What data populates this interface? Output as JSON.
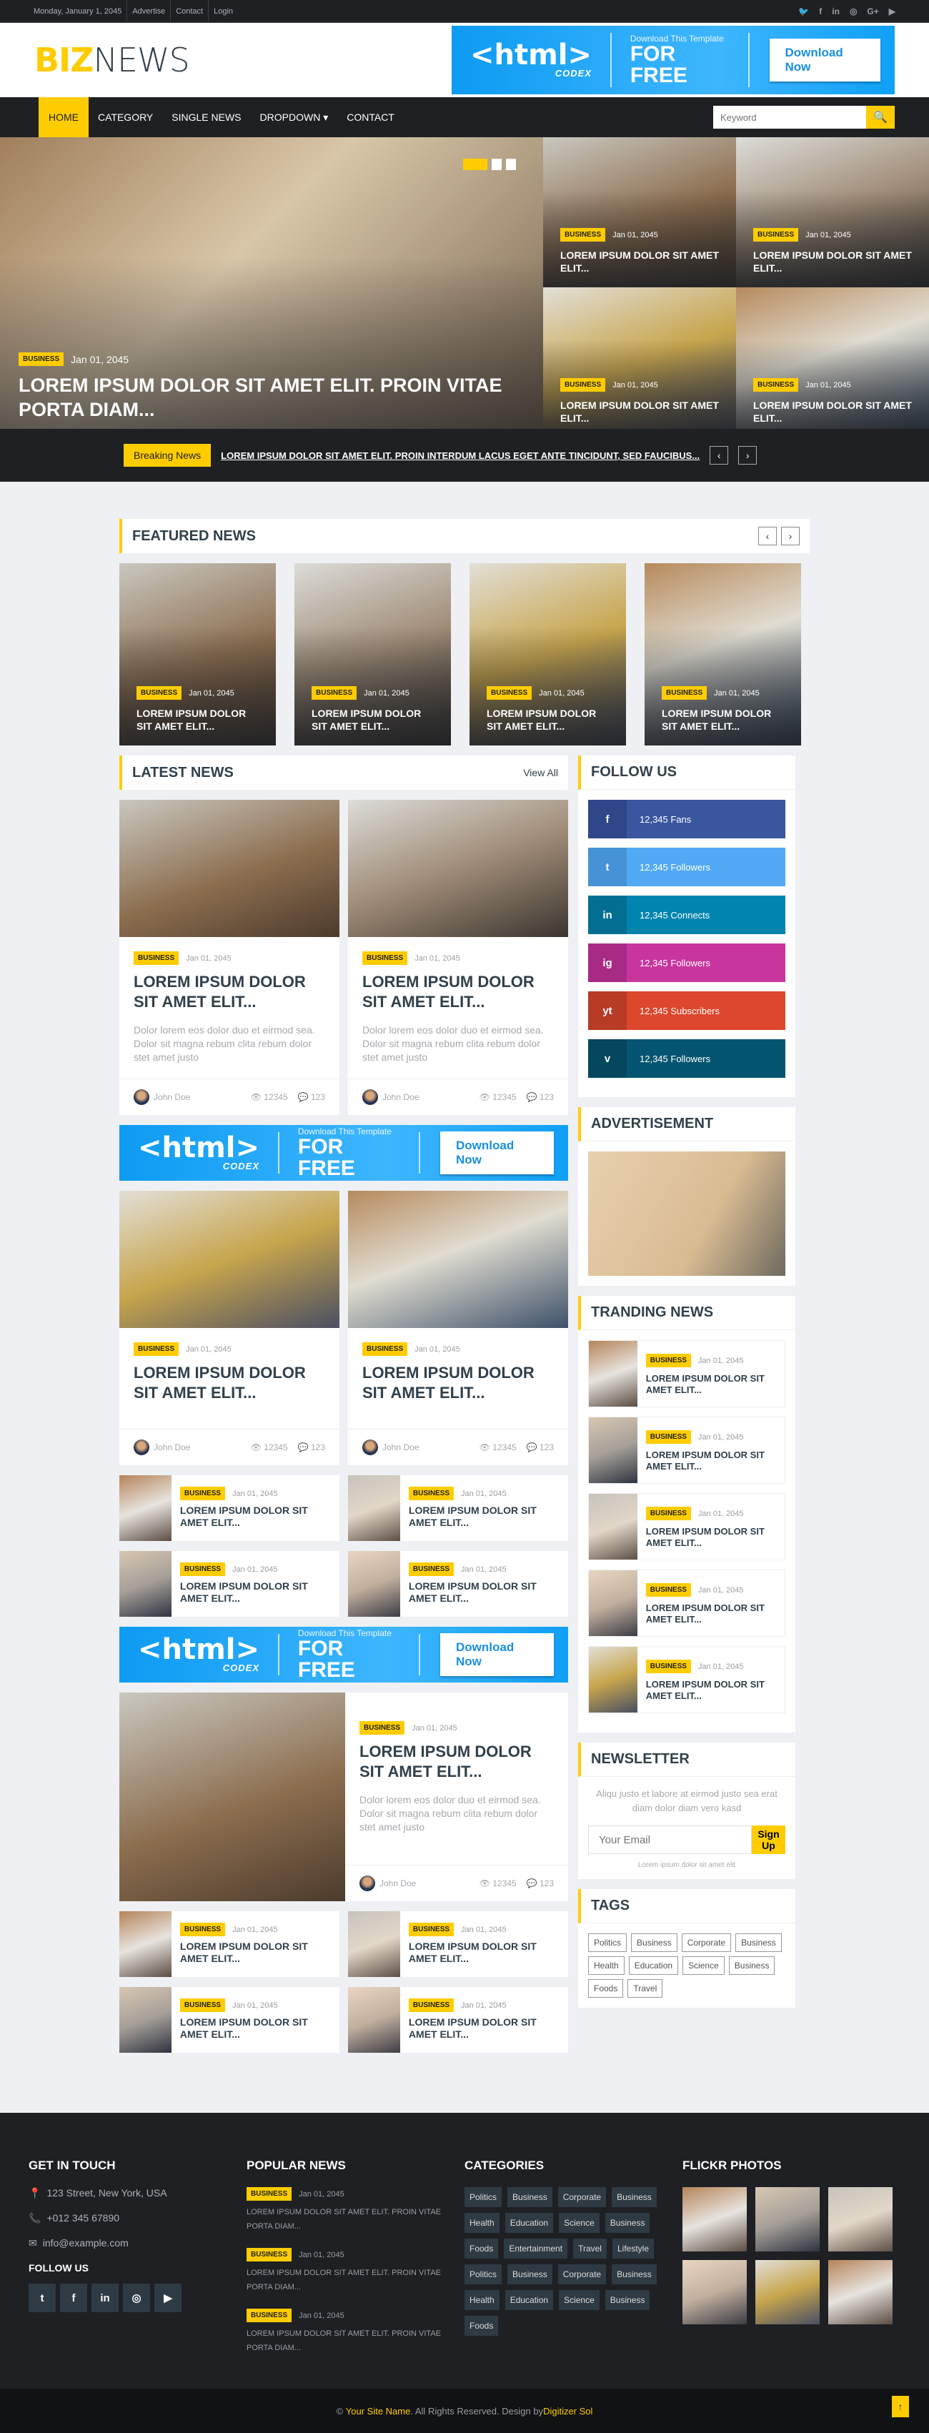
{
  "topbar": {
    "links": [
      "Monday, January 1, 2045",
      "Advertise",
      "Contact",
      "Login"
    ],
    "social_icons": [
      "twitter-icon",
      "facebook-icon",
      "linkedin-icon",
      "instagram-icon",
      "google-plus-icon",
      "youtube-icon"
    ]
  },
  "brand": {
    "logo_left": "BIZ",
    "logo_right": "NEWS"
  },
  "banner": {
    "html": "<html>",
    "codex": "CODEX",
    "download_text": "Download This Template",
    "for_free": "FOR FREE",
    "button": "Download Now"
  },
  "nav": {
    "items": [
      "HOME",
      "CATEGORY",
      "SINGLE NEWS",
      "DROPDOWN ▾",
      "CONTACT"
    ],
    "active": "HOME",
    "search_placeholder": "Keyword"
  },
  "hero": {
    "main": {
      "category": "BUSINESS",
      "date": "Jan 01, 2045",
      "title": "LOREM IPSUM DOLOR SIT AMET ELIT. PROIN VITAE PORTA DIAM..."
    },
    "side": [
      {
        "category": "BUSINESS",
        "date": "Jan 01, 2045",
        "title": "LOREM IPSUM DOLOR SIT AMET ELIT..."
      },
      {
        "category": "BUSINESS",
        "date": "Jan 01, 2045",
        "title": "LOREM IPSUM DOLOR SIT AMET ELIT..."
      },
      {
        "category": "BUSINESS",
        "date": "Jan 01, 2045",
        "title": "LOREM IPSUM DOLOR SIT AMET ELIT..."
      },
      {
        "category": "BUSINESS",
        "date": "Jan 01, 2045",
        "title": "LOREM IPSUM DOLOR SIT AMET ELIT..."
      }
    ]
  },
  "breaking": {
    "label": "Breaking News",
    "text": "LOREM IPSUM DOLOR SIT AMET ELIT. PROIN INTERDUM LACUS EGET ANTE TINCIDUNT, SED FAUCIBUS..."
  },
  "featured": {
    "title": "FEATURED NEWS",
    "items": [
      {
        "category": "BUSINESS",
        "date": "Jan 01, 2045",
        "title": "LOREM IPSUM DOLOR SIT AMET ELIT..."
      },
      {
        "category": "BUSINESS",
        "date": "Jan 01, 2045",
        "title": "LOREM IPSUM DOLOR SIT AMET ELIT..."
      },
      {
        "category": "BUSINESS",
        "date": "Jan 01, 2045",
        "title": "LOREM IPSUM DOLOR SIT AMET ELIT..."
      },
      {
        "category": "BUSINESS",
        "date": "Jan 01, 2045",
        "title": "LOREM IPSUM DOLOR SIT AMET ELIT..."
      }
    ]
  },
  "latest": {
    "title": "LATEST NEWS",
    "view_all": "View All",
    "card_category": "BUSINESS",
    "card_date": "Jan 01, 2045",
    "card_title": "LOREM IPSUM DOLOR SIT AMET ELIT...",
    "card_text": "Dolor lorem eos dolor duo et eirmod sea. Dolor sit magna rebum clita rebum dolor stet amet justo",
    "author": "John Doe",
    "views": "12345",
    "comments": "123",
    "small_title": "LOREM IPSUM DOLOR SIT AMET ELIT..."
  },
  "follow": {
    "title": "FOLLOW US",
    "items": [
      {
        "icon": "f",
        "text": "12,345 Fans",
        "color": "#39569e",
        "dark": "#2f4788"
      },
      {
        "icon": "t",
        "text": "12,345 Followers",
        "color": "#52aaf4",
        "dark": "#4593d6"
      },
      {
        "icon": "in",
        "text": "12,345 Connects",
        "color": "#0185ae",
        "dark": "#026f92"
      },
      {
        "icon": "ig",
        "text": "12,345 Followers",
        "color": "#c8359d",
        "dark": "#a72b84"
      },
      {
        "icon": "yt",
        "text": "12,345 Subscribers",
        "color": "#dc472e",
        "dark": "#b83b26"
      },
      {
        "icon": "v",
        "text": "12,345 Followers",
        "color": "#055570",
        "dark": "#04475e"
      }
    ]
  },
  "advertisement": {
    "title": "ADVERTISEMENT"
  },
  "trending": {
    "title": "TRANDING NEWS",
    "category": "BUSINESS",
    "date": "Jan 01, 2045",
    "item_title": "LOREM IPSUM DOLOR SIT AMET ELIT..."
  },
  "newsletter": {
    "title": "NEWSLETTER",
    "text": "Aliqu justo et labore at eirmod justo sea erat diam dolor diam vero kasd",
    "placeholder": "Your Email",
    "button": "Sign Up",
    "note": "Lorem ipsum dolor sit amet elit"
  },
  "tags": {
    "title": "TAGS",
    "items": [
      "Politics",
      "Business",
      "Corporate",
      "Business",
      "Health",
      "Education",
      "Science",
      "Business",
      "Foods",
      "Travel"
    ]
  },
  "footer": {
    "contact_title": "GET IN TOUCH",
    "address": "123 Street, New York, USA",
    "phone": "+012 345 67890",
    "email": "info@example.com",
    "follow_title": "FOLLOW US",
    "popular_title": "POPULAR NEWS",
    "popular": [
      {
        "category": "BUSINESS",
        "date": "Jan 01, 2045",
        "title": "LOREM IPSUM DOLOR SIT AMET ELIT. PROIN VITAE PORTA DIAM..."
      },
      {
        "category": "BUSINESS",
        "date": "Jan 01, 2045",
        "title": "LOREM IPSUM DOLOR SIT AMET ELIT. PROIN VITAE PORTA DIAM..."
      },
      {
        "category": "BUSINESS",
        "date": "Jan 01, 2045",
        "title": "LOREM IPSUM DOLOR SIT AMET ELIT. PROIN VITAE PORTA DIAM..."
      }
    ],
    "categories_title": "CATEGORIES",
    "categories": [
      "Politics",
      "Business",
      "Corporate",
      "Business",
      "Health",
      "Education",
      "Science",
      "Business",
      "Foods",
      "Entertainment",
      "Travel",
      "Lifestyle",
      "Politics",
      "Business",
      "Corporate",
      "Business",
      "Health",
      "Education",
      "Science",
      "Business",
      "Foods"
    ],
    "flickr_title": "FLICKR PHOTOS"
  },
  "copyright": {
    "symbol": "©",
    "site": "Your Site Name",
    "middle": ". All Rights Reserved. Design by ",
    "designer": "Digitizer Sol"
  }
}
